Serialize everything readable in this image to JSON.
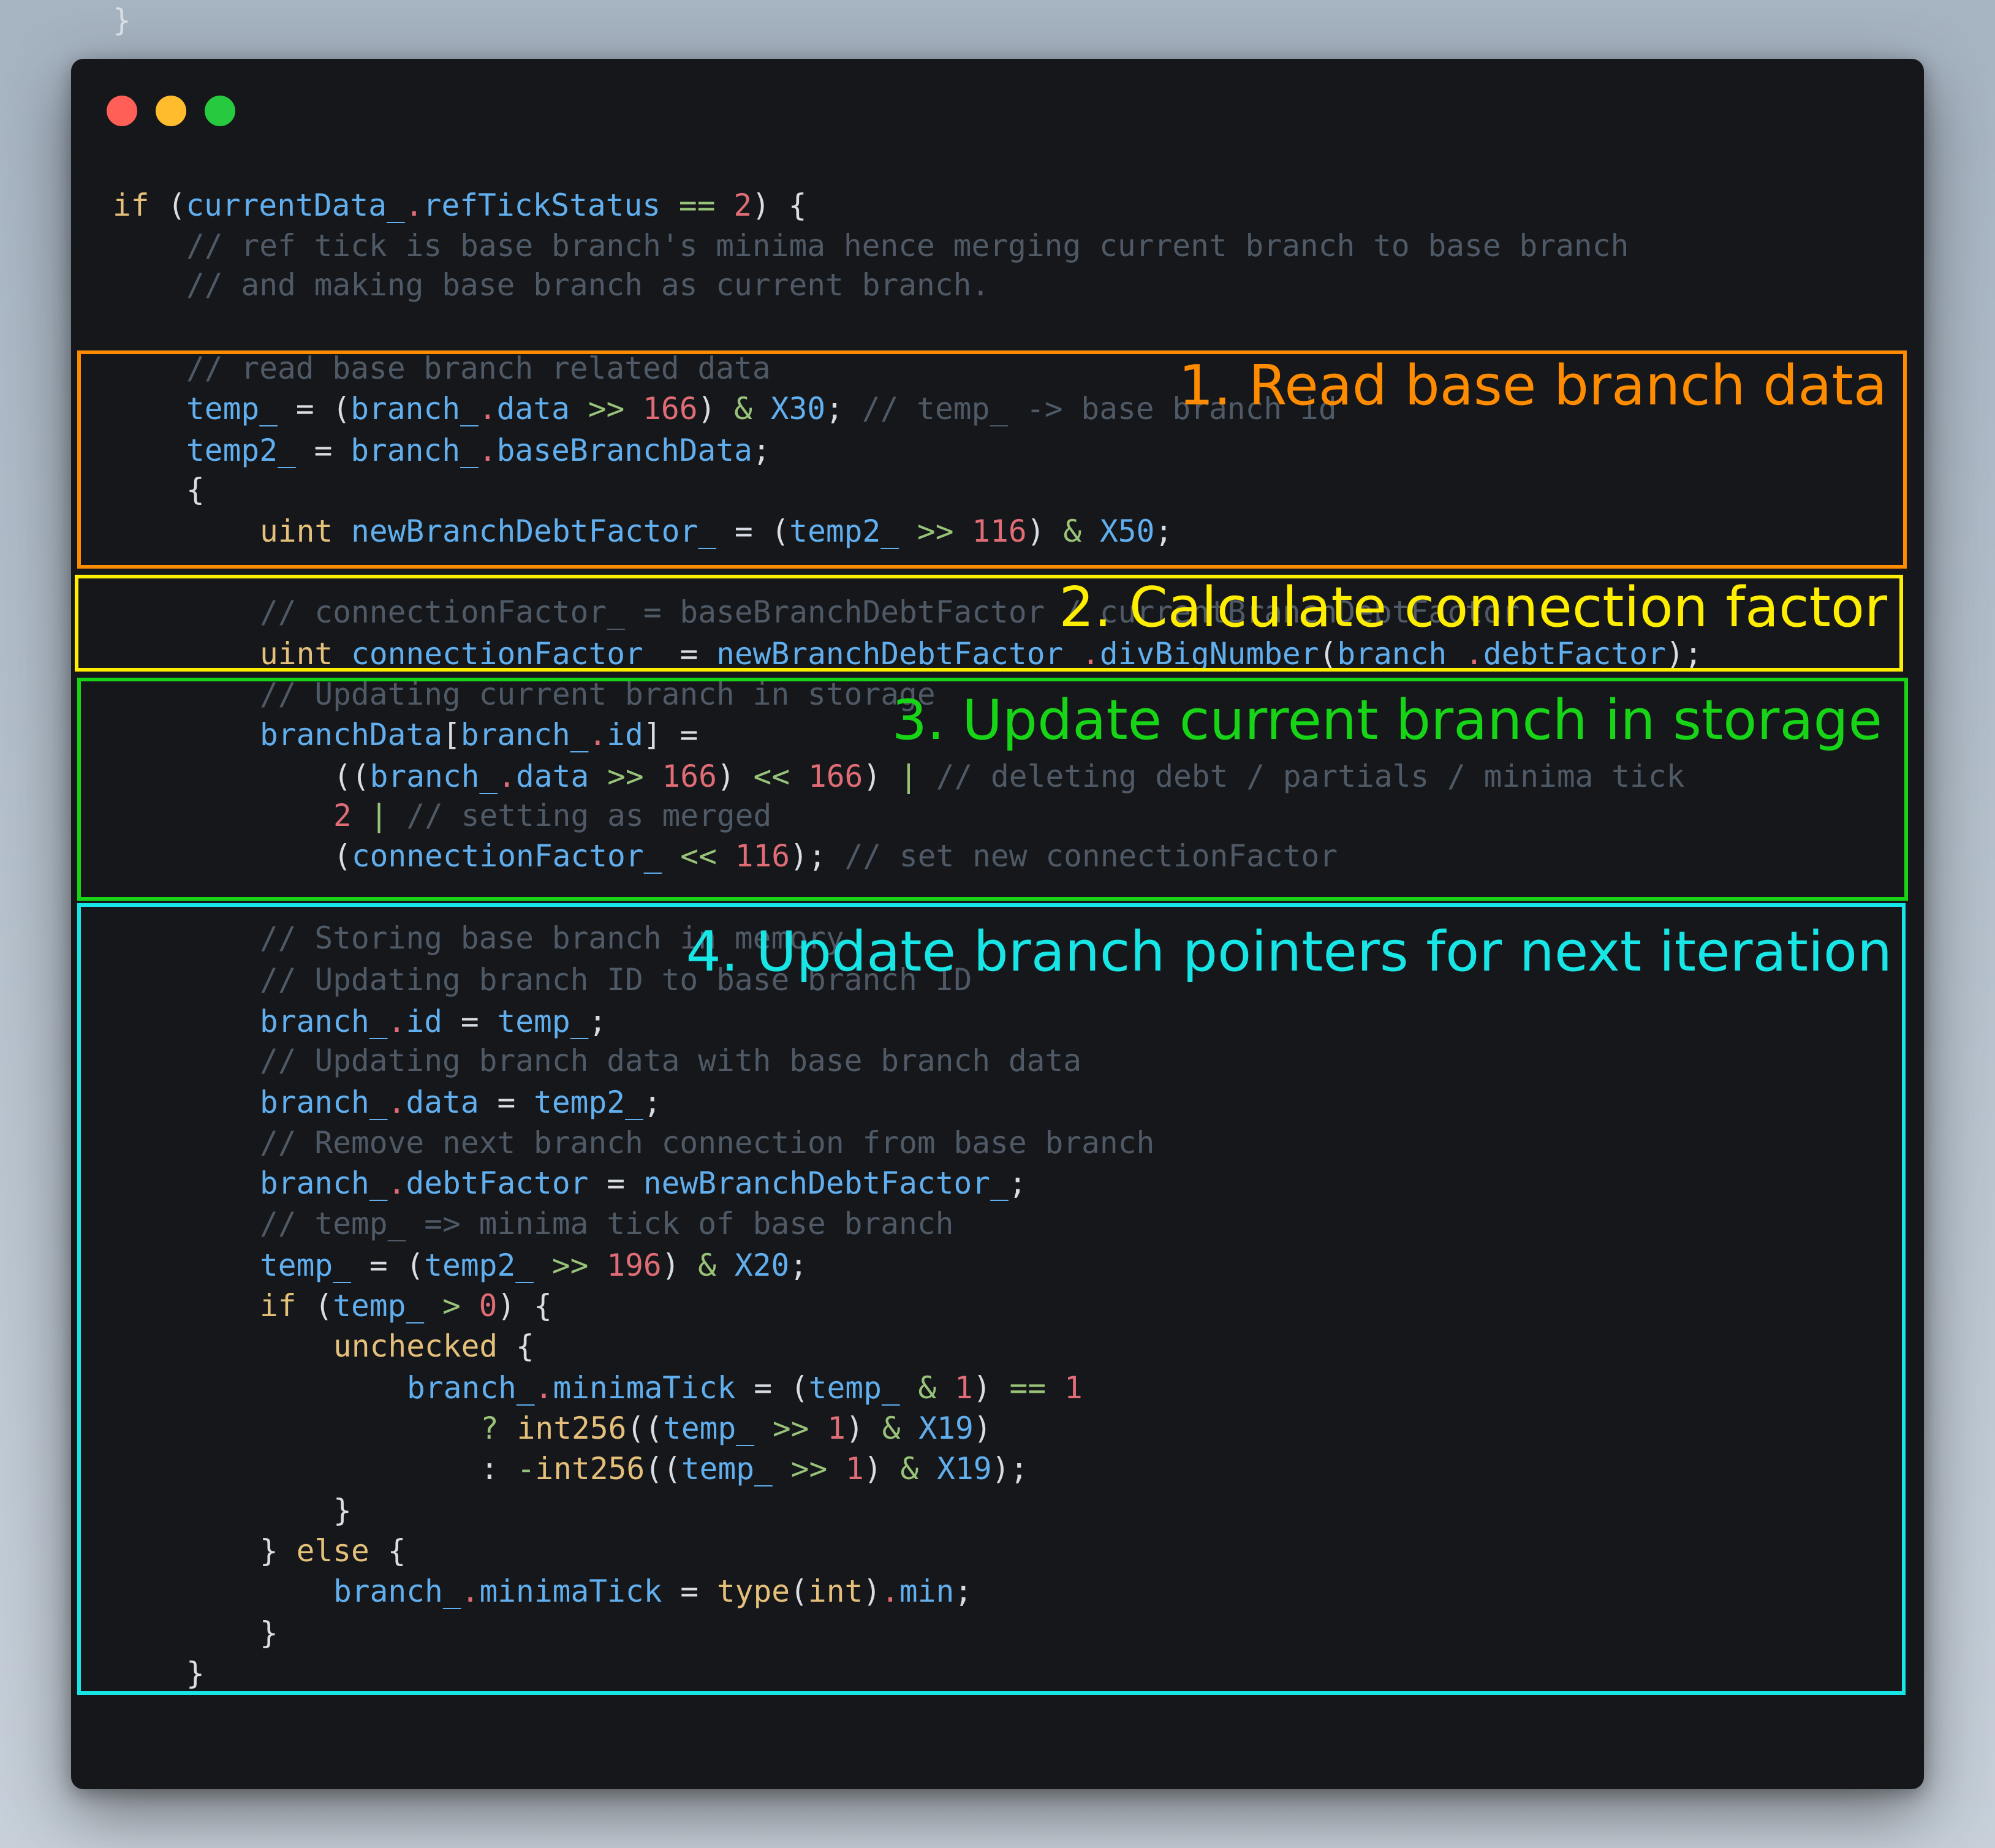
{
  "window_controls": {
    "close": "close-icon",
    "minimize": "minimize-icon",
    "zoom": "zoom-icon"
  },
  "colors": {
    "keyword": "#e5c07b",
    "identifier": "#61afef",
    "number": "#e06c75",
    "operator": "#98c379",
    "comment": "#4f5a66",
    "text": "#d8dde4",
    "box1": "#ff8c00",
    "box2": "#ffee00",
    "box3": "#17d417",
    "box4": "#18e6e6"
  },
  "annotations": [
    {
      "label": "1. Read base branch data"
    },
    {
      "label": "2. Calculate connection factor"
    },
    {
      "label": "3. Update current branch in storage"
    },
    {
      "label": "4. Update branch pointers for next iteration"
    }
  ],
  "code_lines": [
    {
      "indent": 0,
      "tokens": [
        [
          "kw",
          "if"
        ],
        [
          "pu",
          " ("
        ],
        [
          "id",
          "currentData_"
        ],
        [
          "num",
          "."
        ],
        [
          "id",
          "refTickStatus"
        ],
        [
          "pu",
          " "
        ],
        [
          "op",
          "=="
        ],
        [
          "pu",
          " "
        ],
        [
          "num",
          "2"
        ],
        [
          "pu",
          ") {"
        ]
      ]
    },
    {
      "indent": 4,
      "tokens": [
        [
          "cm",
          "// ref tick is base branch's minima hence merging current branch to base branch"
        ]
      ]
    },
    {
      "indent": 4,
      "tokens": [
        [
          "cm",
          "// and making base branch as current branch."
        ]
      ]
    },
    {
      "indent": 4,
      "tokens": [
        [
          "cm",
          "// read base branch related data"
        ]
      ]
    },
    {
      "indent": 4,
      "tokens": [
        [
          "id",
          "temp_"
        ],
        [
          "pu",
          " = ("
        ],
        [
          "id",
          "branch_"
        ],
        [
          "num",
          "."
        ],
        [
          "id",
          "data"
        ],
        [
          "pu",
          " "
        ],
        [
          "op",
          ">>"
        ],
        [
          "pu",
          " "
        ],
        [
          "num",
          "166"
        ],
        [
          "pu",
          ") "
        ],
        [
          "op",
          "&"
        ],
        [
          "pu",
          " "
        ],
        [
          "id",
          "X30"
        ],
        [
          "pu",
          "; "
        ],
        [
          "cm",
          "// temp_ -> base branch id"
        ]
      ]
    },
    {
      "indent": 4,
      "tokens": [
        [
          "id",
          "temp2_"
        ],
        [
          "pu",
          " = "
        ],
        [
          "id",
          "branch_"
        ],
        [
          "num",
          "."
        ],
        [
          "id",
          "baseBranchData"
        ],
        [
          "pu",
          ";"
        ]
      ]
    },
    {
      "indent": 4,
      "tokens": [
        [
          "pu",
          "{"
        ]
      ]
    },
    {
      "indent": 8,
      "tokens": [
        [
          "kw",
          "uint"
        ],
        [
          "pu",
          " "
        ],
        [
          "id",
          "newBranchDebtFactor_"
        ],
        [
          "pu",
          " = ("
        ],
        [
          "id",
          "temp2_"
        ],
        [
          "pu",
          " "
        ],
        [
          "op",
          ">>"
        ],
        [
          "pu",
          " "
        ],
        [
          "num",
          "116"
        ],
        [
          "pu",
          ") "
        ],
        [
          "op",
          "&"
        ],
        [
          "pu",
          " "
        ],
        [
          "id",
          "X50"
        ],
        [
          "pu",
          ";"
        ]
      ]
    },
    {
      "indent": 8,
      "tokens": [
        [
          "cm",
          "// connectionFactor_ = baseBranchDebtFactor / currentBranchDebtFactor"
        ]
      ]
    },
    {
      "indent": 8,
      "tokens": [
        [
          "kw",
          "uint"
        ],
        [
          "pu",
          " "
        ],
        [
          "id",
          "connectionFactor_"
        ],
        [
          "pu",
          " = "
        ],
        [
          "id",
          "newBranchDebtFactor_"
        ],
        [
          "num",
          "."
        ],
        [
          "id",
          "divBigNumber"
        ],
        [
          "pu",
          "("
        ],
        [
          "id",
          "branch_"
        ],
        [
          "num",
          "."
        ],
        [
          "id",
          "debtFactor"
        ],
        [
          "pu",
          ");"
        ]
      ]
    },
    {
      "indent": 8,
      "tokens": [
        [
          "cm",
          "// Updating current branch in storage"
        ]
      ]
    },
    {
      "indent": 8,
      "tokens": [
        [
          "id",
          "branchData"
        ],
        [
          "pu",
          "["
        ],
        [
          "id",
          "branch_"
        ],
        [
          "num",
          "."
        ],
        [
          "id",
          "id"
        ],
        [
          "pu",
          "] ="
        ]
      ]
    },
    {
      "indent": 12,
      "tokens": [
        [
          "pu",
          "(("
        ],
        [
          "id",
          "branch_"
        ],
        [
          "num",
          "."
        ],
        [
          "id",
          "data"
        ],
        [
          "pu",
          " "
        ],
        [
          "op",
          ">>"
        ],
        [
          "pu",
          " "
        ],
        [
          "num",
          "166"
        ],
        [
          "pu",
          ") "
        ],
        [
          "op",
          "<<"
        ],
        [
          "pu",
          " "
        ],
        [
          "num",
          "166"
        ],
        [
          "pu",
          ") "
        ],
        [
          "op",
          "|"
        ],
        [
          "pu",
          " "
        ],
        [
          "cm",
          "// deleting debt / partials / minima tick"
        ]
      ]
    },
    {
      "indent": 12,
      "tokens": [
        [
          "num",
          "2"
        ],
        [
          "pu",
          " "
        ],
        [
          "op",
          "|"
        ],
        [
          "pu",
          " "
        ],
        [
          "cm",
          "// setting as merged"
        ]
      ]
    },
    {
      "indent": 12,
      "tokens": [
        [
          "pu",
          "("
        ],
        [
          "id",
          "connectionFactor_"
        ],
        [
          "pu",
          " "
        ],
        [
          "op",
          "<<"
        ],
        [
          "pu",
          " "
        ],
        [
          "num",
          "116"
        ],
        [
          "pu",
          "); "
        ],
        [
          "cm",
          "// set new connectionFactor"
        ]
      ]
    },
    {
      "indent": 8,
      "tokens": [
        [
          "cm",
          "// Storing base branch in memory"
        ]
      ]
    },
    {
      "indent": 8,
      "tokens": [
        [
          "cm",
          "// Updating branch ID to base branch ID"
        ]
      ]
    },
    {
      "indent": 8,
      "tokens": [
        [
          "id",
          "branch_"
        ],
        [
          "num",
          "."
        ],
        [
          "id",
          "id"
        ],
        [
          "pu",
          " = "
        ],
        [
          "id",
          "temp_"
        ],
        [
          "pu",
          ";"
        ]
      ]
    },
    {
      "indent": 8,
      "tokens": [
        [
          "cm",
          "// Updating branch data with base branch data"
        ]
      ]
    },
    {
      "indent": 8,
      "tokens": [
        [
          "id",
          "branch_"
        ],
        [
          "num",
          "."
        ],
        [
          "id",
          "data"
        ],
        [
          "pu",
          " = "
        ],
        [
          "id",
          "temp2_"
        ],
        [
          "pu",
          ";"
        ]
      ]
    },
    {
      "indent": 8,
      "tokens": [
        [
          "cm",
          "// Remove next branch connection from base branch"
        ]
      ]
    },
    {
      "indent": 8,
      "tokens": [
        [
          "id",
          "branch_"
        ],
        [
          "num",
          "."
        ],
        [
          "id",
          "debtFactor"
        ],
        [
          "pu",
          " = "
        ],
        [
          "id",
          "newBranchDebtFactor_"
        ],
        [
          "pu",
          ";"
        ]
      ]
    },
    {
      "indent": 8,
      "tokens": [
        [
          "cm",
          "// temp_ => minima tick of base branch"
        ]
      ]
    },
    {
      "indent": 8,
      "tokens": [
        [
          "id",
          "temp_"
        ],
        [
          "pu",
          " = ("
        ],
        [
          "id",
          "temp2_"
        ],
        [
          "pu",
          " "
        ],
        [
          "op",
          ">>"
        ],
        [
          "pu",
          " "
        ],
        [
          "num",
          "196"
        ],
        [
          "pu",
          ") "
        ],
        [
          "op",
          "&"
        ],
        [
          "pu",
          " "
        ],
        [
          "id",
          "X20"
        ],
        [
          "pu",
          ";"
        ]
      ]
    },
    {
      "indent": 8,
      "tokens": [
        [
          "kw",
          "if"
        ],
        [
          "pu",
          " ("
        ],
        [
          "id",
          "temp_"
        ],
        [
          "pu",
          " "
        ],
        [
          "op",
          ">"
        ],
        [
          "pu",
          " "
        ],
        [
          "num",
          "0"
        ],
        [
          "pu",
          ") {"
        ]
      ]
    },
    {
      "indent": 12,
      "tokens": [
        [
          "kw",
          "unchecked"
        ],
        [
          "pu",
          " {"
        ]
      ]
    },
    {
      "indent": 16,
      "tokens": [
        [
          "id",
          "branch_"
        ],
        [
          "num",
          "."
        ],
        [
          "id",
          "minimaTick"
        ],
        [
          "pu",
          " = ("
        ],
        [
          "id",
          "temp_"
        ],
        [
          "pu",
          " "
        ],
        [
          "op",
          "&"
        ],
        [
          "pu",
          " "
        ],
        [
          "num",
          "1"
        ],
        [
          "pu",
          ") "
        ],
        [
          "op",
          "=="
        ],
        [
          "pu",
          " "
        ],
        [
          "num",
          "1"
        ]
      ]
    },
    {
      "indent": 20,
      "tokens": [
        [
          "op",
          "?"
        ],
        [
          "pu",
          " "
        ],
        [
          "kw",
          "int256"
        ],
        [
          "pu",
          "(("
        ],
        [
          "id",
          "temp_"
        ],
        [
          "pu",
          " "
        ],
        [
          "op",
          ">>"
        ],
        [
          "pu",
          " "
        ],
        [
          "num",
          "1"
        ],
        [
          "pu",
          ") "
        ],
        [
          "op",
          "&"
        ],
        [
          "pu",
          " "
        ],
        [
          "id",
          "X19"
        ],
        [
          "pu",
          ")"
        ]
      ]
    },
    {
      "indent": 20,
      "tokens": [
        [
          "pu",
          ": "
        ],
        [
          "op",
          "-"
        ],
        [
          "kw",
          "int256"
        ],
        [
          "pu",
          "(("
        ],
        [
          "id",
          "temp_"
        ],
        [
          "pu",
          " "
        ],
        [
          "op",
          ">>"
        ],
        [
          "pu",
          " "
        ],
        [
          "num",
          "1"
        ],
        [
          "pu",
          ") "
        ],
        [
          "op",
          "&"
        ],
        [
          "pu",
          " "
        ],
        [
          "id",
          "X19"
        ],
        [
          "pu",
          ");"
        ]
      ]
    },
    {
      "indent": 12,
      "tokens": [
        [
          "pu",
          "}"
        ]
      ]
    },
    {
      "indent": 8,
      "tokens": [
        [
          "pu",
          "} "
        ],
        [
          "kw",
          "else"
        ],
        [
          "pu",
          " {"
        ]
      ]
    },
    {
      "indent": 12,
      "tokens": [
        [
          "id",
          "branch_"
        ],
        [
          "num",
          "."
        ],
        [
          "id",
          "minimaTick"
        ],
        [
          "pu",
          " = "
        ],
        [
          "kw",
          "type"
        ],
        [
          "pu",
          "("
        ],
        [
          "kw",
          "int"
        ],
        [
          "pu",
          ")"
        ],
        [
          "num",
          "."
        ],
        [
          "id",
          "min"
        ],
        [
          "pu",
          ";"
        ]
      ]
    },
    {
      "indent": 8,
      "tokens": [
        [
          "pu",
          "}"
        ]
      ]
    },
    {
      "indent": 4,
      "tokens": [
        [
          "pu",
          "}"
        ]
      ]
    },
    {
      "indent": 0,
      "tokens": [
        [
          "pu",
          "}"
        ]
      ]
    }
  ]
}
